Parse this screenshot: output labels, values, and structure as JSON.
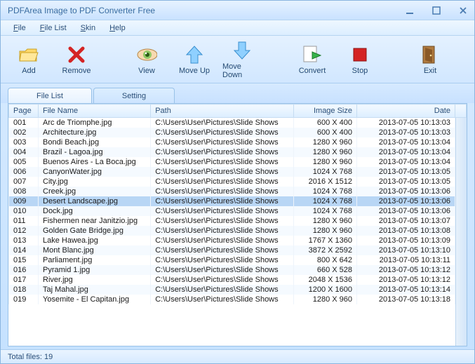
{
  "title": "PDFArea Image to PDF Converter Free",
  "menubar": [
    "File",
    "File List",
    "Skin",
    "Help"
  ],
  "toolbar": {
    "add": "Add",
    "remove": "Remove",
    "view": "View",
    "moveup": "Move Up",
    "movedown": "Move Down",
    "convert": "Convert",
    "stop": "Stop",
    "exit": "Exit"
  },
  "tabs": {
    "filelist": "File List",
    "setting": "Setting"
  },
  "headers": {
    "page": "Page",
    "filename": "File Name",
    "path": "Path",
    "size": "Image Size",
    "date": "Date"
  },
  "selected_index": 8,
  "rows": [
    {
      "page": "001",
      "filename": "Arc de Triomphe.jpg",
      "path": "C:\\Users\\User\\Pictures\\Slide Shows",
      "size": "600 X 400",
      "date": "2013-07-05 10:13:03"
    },
    {
      "page": "002",
      "filename": "Architecture.jpg",
      "path": "C:\\Users\\User\\Pictures\\Slide Shows",
      "size": "600 X 400",
      "date": "2013-07-05 10:13:03"
    },
    {
      "page": "003",
      "filename": "Bondi Beach.jpg",
      "path": "C:\\Users\\User\\Pictures\\Slide Shows",
      "size": "1280 X 960",
      "date": "2013-07-05 10:13:04"
    },
    {
      "page": "004",
      "filename": "Brazil - Lagoa.jpg",
      "path": "C:\\Users\\User\\Pictures\\Slide Shows",
      "size": "1280 X 960",
      "date": "2013-07-05 10:13:04"
    },
    {
      "page": "005",
      "filename": "Buenos Aires - La Boca.jpg",
      "path": "C:\\Users\\User\\Pictures\\Slide Shows",
      "size": "1280 X 960",
      "date": "2013-07-05 10:13:04"
    },
    {
      "page": "006",
      "filename": "CanyonWater.jpg",
      "path": "C:\\Users\\User\\Pictures\\Slide Shows",
      "size": "1024 X 768",
      "date": "2013-07-05 10:13:05"
    },
    {
      "page": "007",
      "filename": "City.jpg",
      "path": "C:\\Users\\User\\Pictures\\Slide Shows",
      "size": "2016 X 1512",
      "date": "2013-07-05 10:13:05"
    },
    {
      "page": "008",
      "filename": "Creek.jpg",
      "path": "C:\\Users\\User\\Pictures\\Slide Shows",
      "size": "1024 X 768",
      "date": "2013-07-05 10:13:06"
    },
    {
      "page": "009",
      "filename": "Desert Landscape.jpg",
      "path": "C:\\Users\\User\\Pictures\\Slide Shows",
      "size": "1024 X 768",
      "date": "2013-07-05 10:13:06"
    },
    {
      "page": "010",
      "filename": "Dock.jpg",
      "path": "C:\\Users\\User\\Pictures\\Slide Shows",
      "size": "1024 X 768",
      "date": "2013-07-05 10:13:06"
    },
    {
      "page": "011",
      "filename": "Fishermen near Janitzio.jpg",
      "path": "C:\\Users\\User\\Pictures\\Slide Shows",
      "size": "1280 X 960",
      "date": "2013-07-05 10:13:07"
    },
    {
      "page": "012",
      "filename": "Golden Gate Bridge.jpg",
      "path": "C:\\Users\\User\\Pictures\\Slide Shows",
      "size": "1280 X 960",
      "date": "2013-07-05 10:13:08"
    },
    {
      "page": "013",
      "filename": "Lake Hawea.jpg",
      "path": "C:\\Users\\User\\Pictures\\Slide Shows",
      "size": "1767 X 1360",
      "date": "2013-07-05 10:13:09"
    },
    {
      "page": "014",
      "filename": "Mont Blanc.jpg",
      "path": "C:\\Users\\User\\Pictures\\Slide Shows",
      "size": "3872 X 2592",
      "date": "2013-07-05 10:13:10"
    },
    {
      "page": "015",
      "filename": "Parliament.jpg",
      "path": "C:\\Users\\User\\Pictures\\Slide Shows",
      "size": "800 X 642",
      "date": "2013-07-05 10:13:11"
    },
    {
      "page": "016",
      "filename": "Pyramid 1.jpg",
      "path": "C:\\Users\\User\\Pictures\\Slide Shows",
      "size": "660 X 528",
      "date": "2013-07-05 10:13:12"
    },
    {
      "page": "017",
      "filename": "River.jpg",
      "path": "C:\\Users\\User\\Pictures\\Slide Shows",
      "size": "2048 X 1536",
      "date": "2013-07-05 10:13:12"
    },
    {
      "page": "018",
      "filename": "Taj Mahal.jpg",
      "path": "C:\\Users\\User\\Pictures\\Slide Shows",
      "size": "1200 X 1600",
      "date": "2013-07-05 10:13:14"
    },
    {
      "page": "019",
      "filename": "Yosemite - El Capitan.jpg",
      "path": "C:\\Users\\User\\Pictures\\Slide Shows",
      "size": "1280 X 960",
      "date": "2013-07-05 10:13:18"
    }
  ],
  "status": "Total files: 19"
}
